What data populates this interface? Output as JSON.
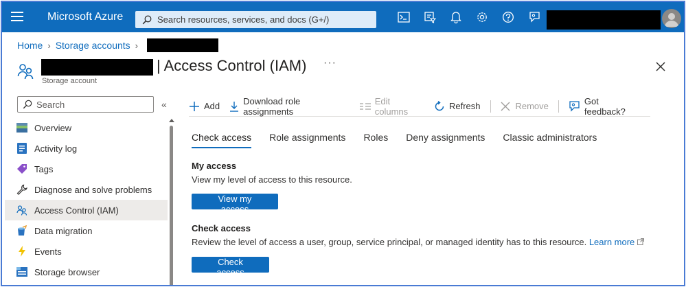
{
  "topbar": {
    "brand": "Microsoft Azure",
    "search_placeholder": "Search resources, services, and docs (G+/)",
    "accent": "#0f6cbd",
    "icons": [
      "cloud-shell-icon",
      "directory-filter-icon",
      "notifications-icon",
      "settings-icon",
      "help-icon",
      "feedback-icon"
    ]
  },
  "breadcrumb": {
    "items": [
      "Home",
      "Storage accounts"
    ]
  },
  "header": {
    "title": "| Access Control (IAM)",
    "subtitle": "Storage account",
    "more": "···"
  },
  "sidebar": {
    "search_placeholder": "Search",
    "collapse": "«",
    "items": [
      {
        "label": "Overview",
        "icon": "overview-icon"
      },
      {
        "label": "Activity log",
        "icon": "activity-log-icon"
      },
      {
        "label": "Tags",
        "icon": "tags-icon"
      },
      {
        "label": "Diagnose and solve problems",
        "icon": "wrench-icon"
      },
      {
        "label": "Access Control (IAM)",
        "icon": "people-icon",
        "active": true
      },
      {
        "label": "Data migration",
        "icon": "data-migration-icon"
      },
      {
        "label": "Events",
        "icon": "lightning-icon"
      },
      {
        "label": "Storage browser",
        "icon": "storage-browser-icon"
      }
    ]
  },
  "toolbar": {
    "add": "Add",
    "download": "Download role assignments",
    "edit_columns": "Edit columns",
    "refresh": "Refresh",
    "remove": "Remove",
    "feedback": "Got feedback?"
  },
  "tabs": [
    "Check access",
    "Role assignments",
    "Roles",
    "Deny assignments",
    "Classic administrators"
  ],
  "my_access": {
    "title": "My access",
    "description": "View my level of access to this resource.",
    "button": "View my access"
  },
  "check_access": {
    "title": "Check access",
    "description": "Review the level of access a user, group, service principal, or managed identity has to this resource.",
    "link": "Learn more",
    "button": "Check access"
  }
}
